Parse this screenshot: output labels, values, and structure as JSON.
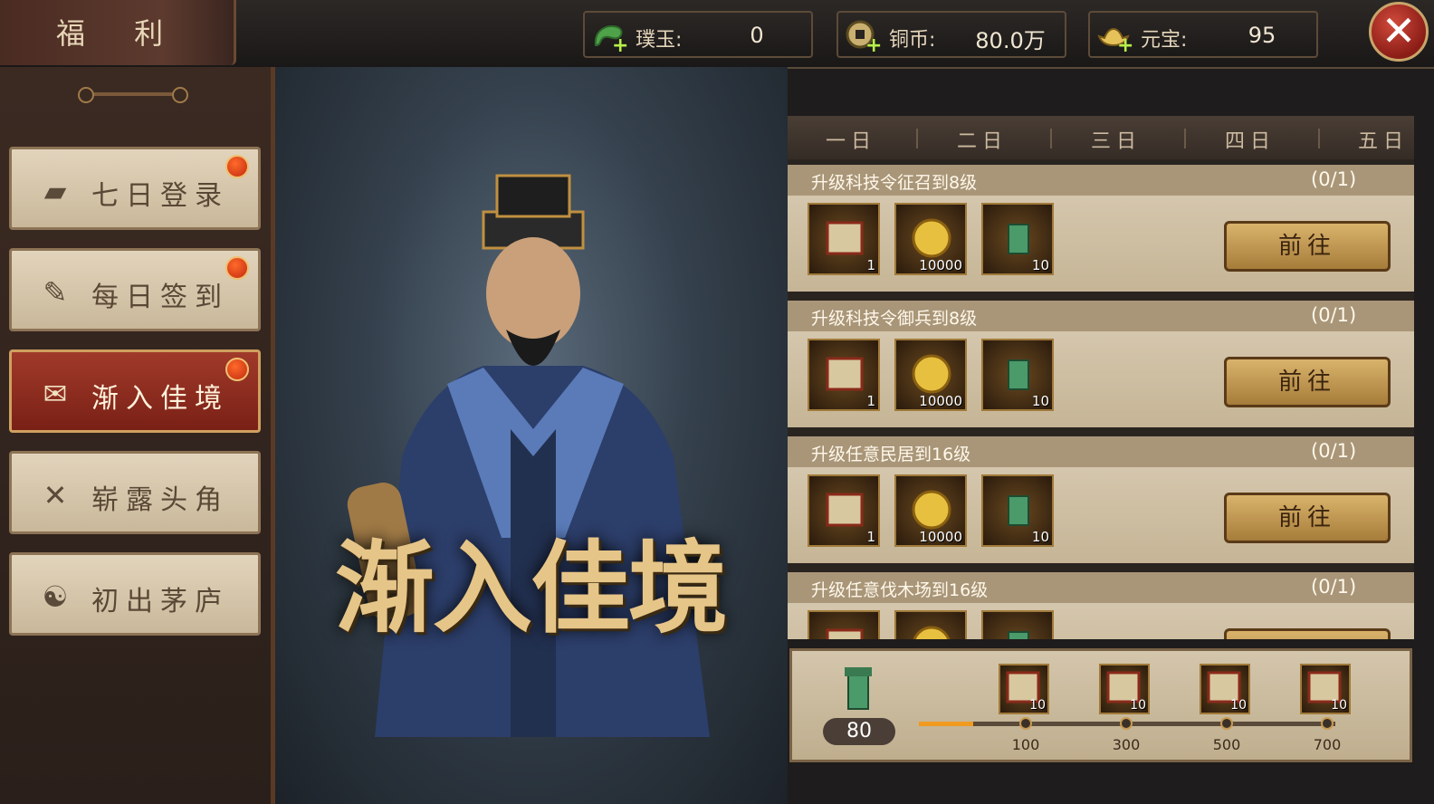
{
  "window": {
    "title": "福 利"
  },
  "resources": [
    {
      "name": "jade",
      "label": "璞玉:",
      "value": "0",
      "icon": "jade-dragon-icon"
    },
    {
      "name": "coins",
      "label": "铜币:",
      "value": "80.0万",
      "icon": "copper-coin-icon"
    },
    {
      "name": "ingots",
      "label": "元宝:",
      "value": "95",
      "icon": "gold-ingot-icon"
    }
  ],
  "close": {
    "label": "✕"
  },
  "sidebar": {
    "items": [
      {
        "label": "七日登录",
        "icon": "books-icon",
        "badge": true,
        "active": false
      },
      {
        "label": "每日签到",
        "icon": "feather-icon",
        "badge": true,
        "active": false
      },
      {
        "label": "渐入佳境",
        "icon": "scroll-icon",
        "badge": true,
        "active": true
      },
      {
        "label": "崭露头角",
        "icon": "crossed-swords-icon",
        "badge": false,
        "active": false
      },
      {
        "label": "初出茅庐",
        "icon": "tornado-icon",
        "badge": false,
        "active": false
      }
    ]
  },
  "hero": {
    "title": "渐入佳境"
  },
  "day_tabs": [
    "一日",
    "二日",
    "三日",
    "四日",
    "五日"
  ],
  "tasks": [
    {
      "name": "升级科技令征召到8级",
      "progress": "(0/1)",
      "button": "前往",
      "rewards": [
        {
          "icon": "recruit-scroll-icon",
          "count": "1"
        },
        {
          "icon": "gold-coin-icon",
          "count": "10000"
        },
        {
          "icon": "jade-seal-icon",
          "count": "10"
        }
      ]
    },
    {
      "name": "升级科技令御兵到8级",
      "progress": "(0/1)",
      "button": "前往",
      "rewards": [
        {
          "icon": "recruit-scroll-icon",
          "count": "1"
        },
        {
          "icon": "gold-coin-icon",
          "count": "10000"
        },
        {
          "icon": "jade-seal-icon",
          "count": "10"
        }
      ]
    },
    {
      "name": "升级任意民居到16级",
      "progress": "(0/1)",
      "button": "前往",
      "rewards": [
        {
          "icon": "recruit-scroll-icon",
          "count": "1"
        },
        {
          "icon": "gold-coin-icon",
          "count": "10000"
        },
        {
          "icon": "jade-seal-icon",
          "count": "10"
        }
      ]
    },
    {
      "name": "升级任意伐木场到16级",
      "progress": "(0/1)",
      "button": "前往",
      "rewards": [
        {
          "icon": "recruit-scroll-icon",
          "count": ""
        },
        {
          "icon": "gold-coin-icon",
          "count": ""
        },
        {
          "icon": "jade-seal-icon",
          "count": ""
        }
      ]
    }
  ],
  "activity": {
    "current": "80",
    "fill_fraction": 0.13,
    "milestones": [
      {
        "threshold": "100",
        "reward_count": "10",
        "icon": "recruit-scroll-icon"
      },
      {
        "threshold": "300",
        "reward_count": "10",
        "icon": "recruit-scroll-icon"
      },
      {
        "threshold": "500",
        "reward_count": "10",
        "icon": "recruit-scroll-icon"
      },
      {
        "threshold": "700",
        "reward_count": "10",
        "icon": "recruit-scroll-icon"
      }
    ]
  },
  "colors": {
    "accent": "#a03a2a",
    "gold": "#d9b36b",
    "progress": "#f09a20"
  }
}
